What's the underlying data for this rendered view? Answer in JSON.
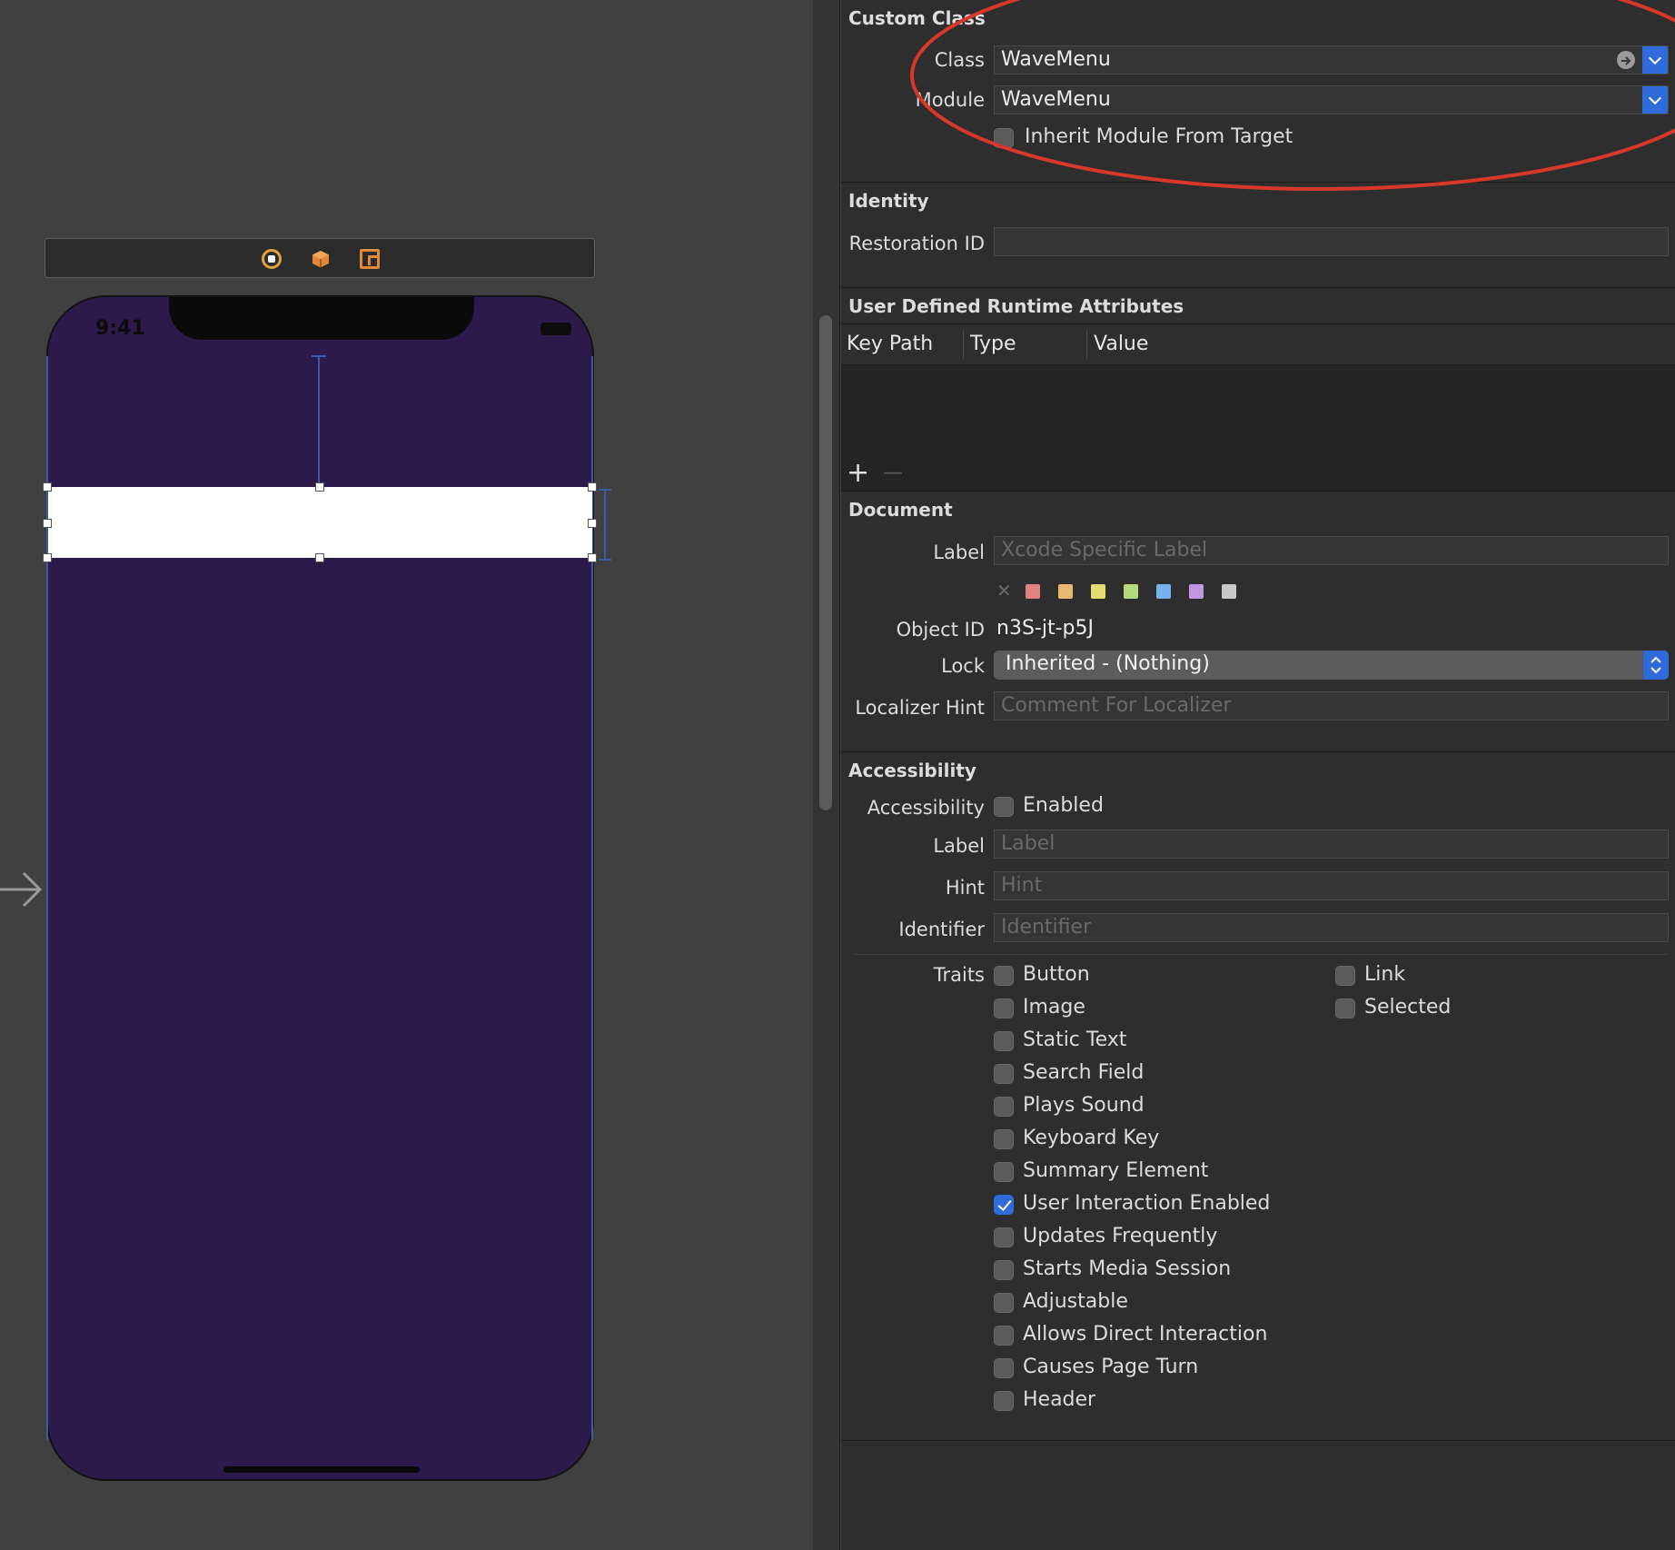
{
  "canvas": {
    "status_time": "9:41",
    "scene_icons": [
      "view-controller-icon",
      "first-responder-icon",
      "exit-icon"
    ],
    "background_color": "#2b1a4a"
  },
  "custom_class": {
    "title": "Custom Class",
    "class_label": "Class",
    "class_value": "WaveMenu",
    "module_label": "Module",
    "module_value": "WaveMenu",
    "inherit_label": "Inherit Module From Target",
    "inherit_checked": false
  },
  "identity": {
    "title": "Identity",
    "restoration_label": "Restoration ID",
    "restoration_value": ""
  },
  "udra": {
    "title": "User Defined Runtime Attributes",
    "columns": [
      "Key Path",
      "Type",
      "Value"
    ],
    "add_symbol": "+",
    "remove_symbol": "—"
  },
  "document": {
    "title": "Document",
    "label_label": "Label",
    "label_placeholder": "Xcode Specific Label",
    "clear_symbol": "✕",
    "swatch_colors": [
      "#e38282",
      "#e8b873",
      "#e6dc74",
      "#b7da7c",
      "#78b2ee",
      "#c197e4",
      "#c8c8c8"
    ],
    "object_id_label": "Object ID",
    "object_id_value": "n3S-jt-p5J",
    "lock_label": "Lock",
    "lock_value": "Inherited - (Nothing)",
    "localizer_label": "Localizer Hint",
    "localizer_placeholder": "Comment For Localizer"
  },
  "accessibility": {
    "title": "Accessibility",
    "accessibility_label": "Accessibility",
    "enabled_label": "Enabled",
    "label_label": "Label",
    "label_placeholder": "Label",
    "hint_label": "Hint",
    "hint_placeholder": "Hint",
    "identifier_label": "Identifier",
    "identifier_placeholder": "Identifier",
    "traits_label": "Traits",
    "traits_left": [
      {
        "label": "Button",
        "checked": false
      },
      {
        "label": "Image",
        "checked": false
      },
      {
        "label": "Static Text",
        "checked": false
      },
      {
        "label": "Search Field",
        "checked": false
      },
      {
        "label": "Plays Sound",
        "checked": false
      },
      {
        "label": "Keyboard Key",
        "checked": false
      },
      {
        "label": "Summary Element",
        "checked": false
      },
      {
        "label": "User Interaction Enabled",
        "checked": true
      },
      {
        "label": "Updates Frequently",
        "checked": false
      },
      {
        "label": "Starts Media Session",
        "checked": false
      },
      {
        "label": "Adjustable",
        "checked": false
      },
      {
        "label": "Allows Direct Interaction",
        "checked": false
      },
      {
        "label": "Causes Page Turn",
        "checked": false
      },
      {
        "label": "Header",
        "checked": false
      }
    ],
    "traits_right": [
      {
        "label": "Link",
        "checked": false
      },
      {
        "label": "Selected",
        "checked": false
      }
    ]
  },
  "annotation_color": "#d8382a"
}
